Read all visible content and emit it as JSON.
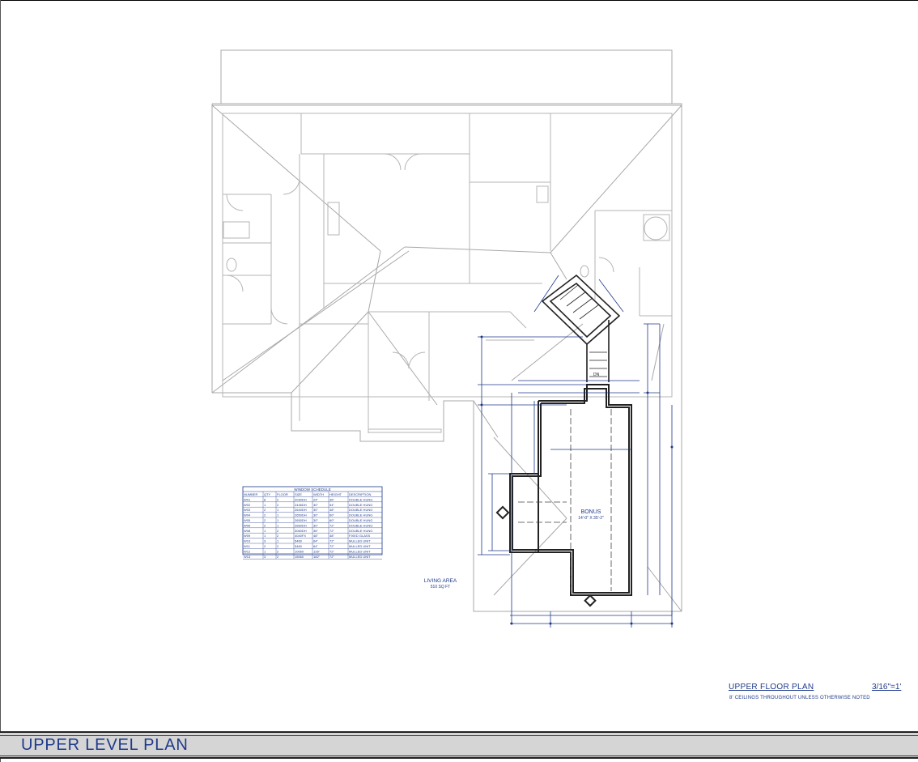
{
  "sheet": {
    "title": "UPPER LEVEL PLAN",
    "watermark": "",
    "plan_title": "UPPER FLOOR PLAN",
    "scale": "3/16\"=1'",
    "note": "8' CEILINGS THROUGHOUT UNLESS OTHERWISE NOTED"
  },
  "room": {
    "name": "BONUS",
    "dimensions": "14'-0\" X 35'-2\""
  },
  "living_area": {
    "label": "LIVING AREA",
    "value": "510 SQ FT"
  },
  "window_schedule": {
    "title": "WINDOW SCHEDULE",
    "columns": [
      "NUMBER",
      "QTY",
      "FLOOR",
      "SIZE",
      "WIDTH",
      "HEIGHT",
      "DESCRIPTION"
    ],
    "rows": [
      [
        "W01",
        "8",
        "2",
        "2030DH",
        "24\"",
        "36\"",
        "DOUBLE HUNG"
      ],
      [
        "W02",
        "1",
        "2",
        "2446DH",
        "30\"",
        "54\"",
        "DOUBLE HUNG"
      ],
      [
        "W03",
        "2",
        "1",
        "2640DH",
        "30\"",
        "48\"",
        "DOUBLE HUNG"
      ],
      [
        "W04",
        "2",
        "1",
        "2650DH",
        "30\"",
        "60\"",
        "DOUBLE HUNG"
      ],
      [
        "W05",
        "2",
        "1",
        "2650DH",
        "30\"",
        "60\"",
        "DOUBLE HUNG"
      ],
      [
        "W06",
        "2",
        "1",
        "2660DH",
        "30\"",
        "72\"",
        "DOUBLE HUNG"
      ],
      [
        "W08",
        "1",
        "2",
        "3060DH",
        "36\"",
        "72\"",
        "DOUBLE HUNG"
      ],
      [
        "W09",
        "1",
        "2",
        "4040FX",
        "48\"",
        "48\"",
        "FIXED GLASS"
      ],
      [
        "W10",
        "3",
        "1",
        "5460",
        "64\"",
        "72\"",
        "MULLED UNIT"
      ],
      [
        "W11",
        "2",
        "2",
        "5460",
        "64\"",
        "72\"",
        "MULLED UNIT"
      ],
      [
        "W12",
        "1",
        "2",
        "10060",
        "126\"",
        "72\"",
        "MULLED UNIT"
      ],
      [
        "W13",
        "3",
        "2",
        "15060",
        "182\"",
        "72\"",
        "MULLED UNIT"
      ]
    ]
  },
  "colors": {
    "annotation": "#1f3a8a",
    "roof_lines": "#9a9a9a",
    "walls": "#222222",
    "bar": "#d5d5d5"
  }
}
